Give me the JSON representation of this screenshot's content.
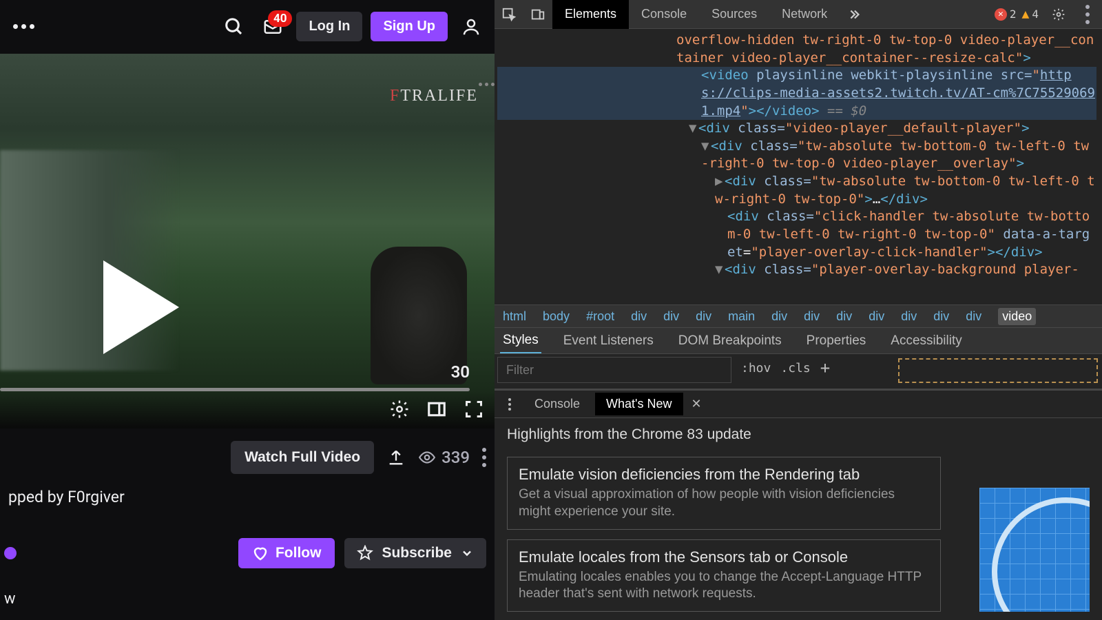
{
  "twitch": {
    "header": {
      "inbox_badge": "40",
      "login": "Log In",
      "signup": "Sign Up"
    },
    "video": {
      "watermark_a": "F",
      "watermark_b": "TRA",
      "watermark_c": "LIFE",
      "duration": "30"
    },
    "below": {
      "watch_full": "Watch Full Video",
      "views": "339",
      "clip_by": "pped by F0rgiver",
      "follow": "Follow",
      "subscribe": "Subscribe",
      "trunc": "w"
    }
  },
  "devtools": {
    "tabs": {
      "elements": "Elements",
      "console": "Console",
      "sources": "Sources",
      "network": "Network"
    },
    "errors": "2",
    "warnings": "4",
    "dom": {
      "l0": "overflow-hidden tw-right-0 tw-top-0 video-player__container video-player__container--resize-calc",
      "l1_tag": "video",
      "l1_attrs": " playsinline webkit-playsinline src=",
      "l1_url": "https://clips-media-assets2.twitch.tv/AT-cm%7C755290691.mp4",
      "l1_end": " == $0",
      "l2_cls": "video-player__default-player",
      "l3_cls": "tw-absolute tw-bottom-0 tw-left-0 tw-right-0 tw-top-0 video-player__overlay",
      "l4_cls": "tw-absolute tw-bottom-0 tw-left-0 tw-right-0 tw-top-0",
      "l5_cls": "click-handler tw-absolute tw-bottom-0 tw-left-0 tw-right-0 tw-top-0",
      "l5_attr2": "data-a-target",
      "l5_val2": "player-overlay-click-handler",
      "l6_cls": "player-overlay-background player-"
    },
    "breadcrumb": [
      "html",
      "body",
      "#root",
      "div",
      "div",
      "div",
      "main",
      "div",
      "div",
      "div",
      "div",
      "div",
      "div",
      "div",
      "video"
    ],
    "styles_tabs": {
      "styles": "Styles",
      "event": "Event Listeners",
      "dom_bp": "DOM Breakpoints",
      "props": "Properties",
      "a11y": "Accessibility"
    },
    "filter_placeholder": "Filter",
    "hov": ":hov",
    "cls": ".cls",
    "drawer": {
      "console": "Console",
      "whatsnew": "What's New",
      "heading": "Highlights from the Chrome 83 update",
      "card1_h": "Emulate vision deficiencies from the Rendering tab",
      "card1_p": "Get a visual approximation of how people with vision deficiencies might experience your site.",
      "card2_h": "Emulate locales from the Sensors tab or Console",
      "card2_p": "Emulating locales enables you to change the Accept-Language HTTP header that's sent with network requests."
    }
  }
}
